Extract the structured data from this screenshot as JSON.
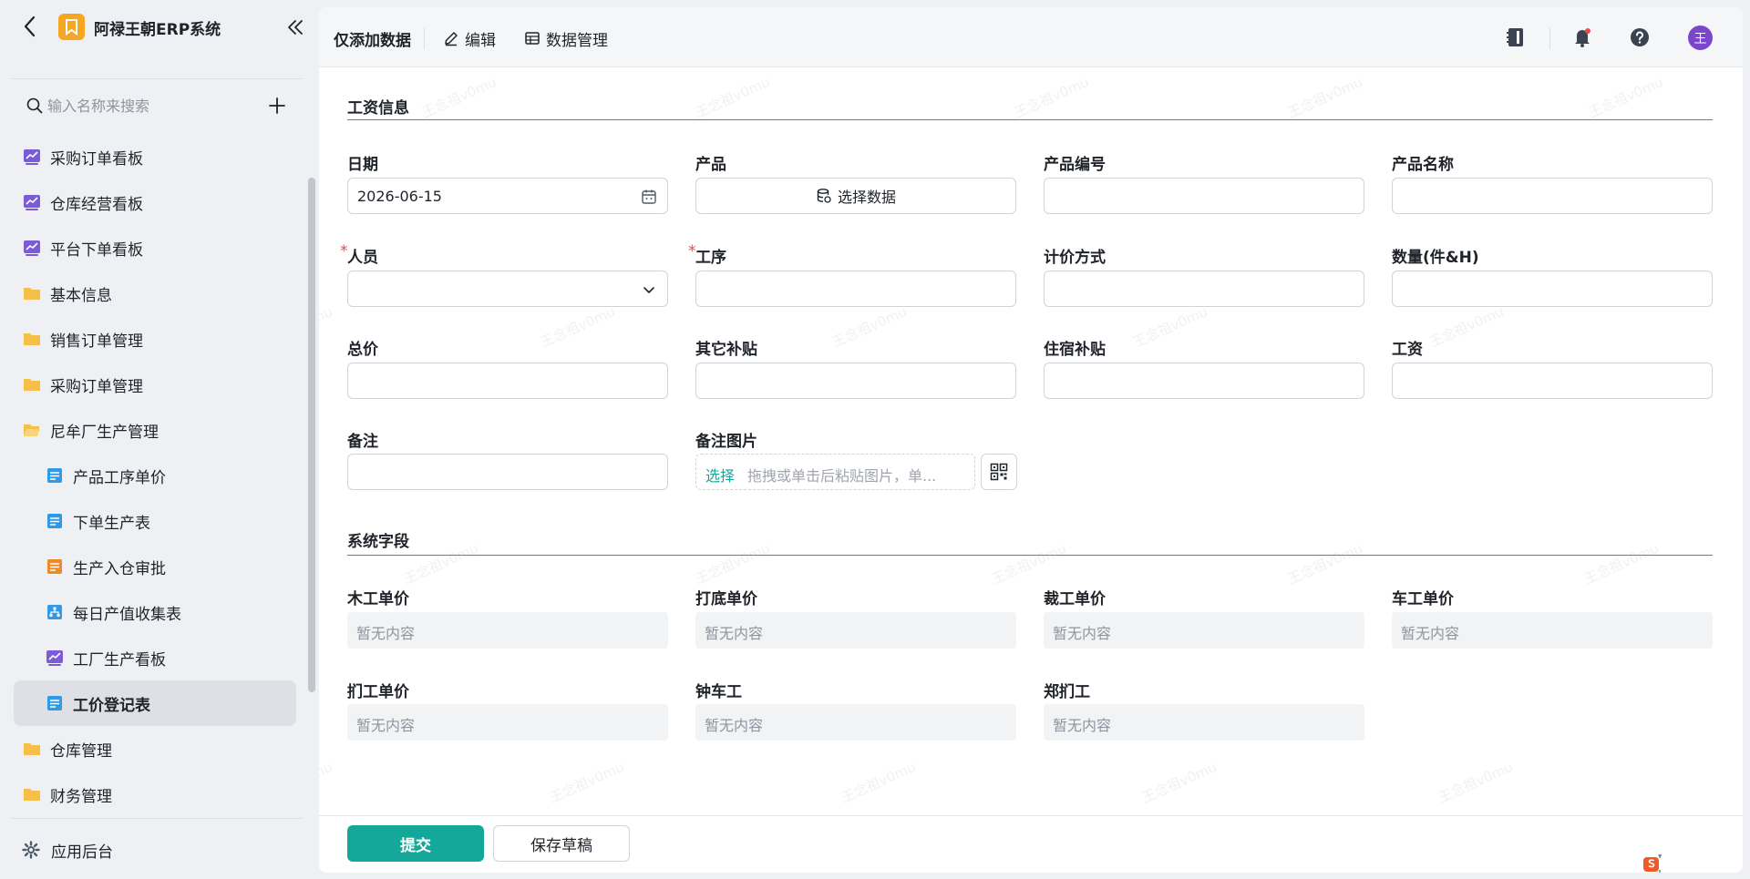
{
  "app": {
    "name": "阿禄王朝ERP系统"
  },
  "sidebar": {
    "search_placeholder": "输入名称来搜索",
    "items": [
      {
        "label": "采购订单看板",
        "icon": "dashboard-chart-icon"
      },
      {
        "label": "仓库经营看板",
        "icon": "dashboard-chart-icon"
      },
      {
        "label": "平台下单看板",
        "icon": "dashboard-chart-icon"
      },
      {
        "label": "基本信息",
        "icon": "folder-icon"
      },
      {
        "label": "销售订单管理",
        "icon": "folder-icon"
      },
      {
        "label": "采购订单管理",
        "icon": "folder-icon"
      },
      {
        "label": "尼牟厂生产管理",
        "icon": "folder-open-icon"
      },
      {
        "label": "产品工序单价",
        "icon": "form-icon"
      },
      {
        "label": "下单生产表",
        "icon": "form-icon"
      },
      {
        "label": "生产入仓审批",
        "icon": "approval-form-icon"
      },
      {
        "label": "每日产值收集表",
        "icon": "org-chart-icon"
      },
      {
        "label": "工厂生产看板",
        "icon": "dashboard-chart-icon"
      },
      {
        "label": "工价登记表",
        "icon": "form-icon",
        "active": true
      },
      {
        "label": "仓库管理",
        "icon": "folder-icon"
      },
      {
        "label": "财务管理",
        "icon": "folder-icon"
      }
    ],
    "footer_label": "应用后台"
  },
  "topbar": {
    "title": "仅添加数据",
    "tabs": [
      "编辑",
      "数据管理"
    ],
    "avatar_text": "王"
  },
  "form": {
    "section1_title": "工资信息",
    "labels": {
      "date": "日期",
      "product": "产品",
      "product_code": "产品编号",
      "product_name": "产品名称",
      "person": "人员",
      "process": "工序",
      "pricing": "计价方式",
      "quantity": "数量(件&H)",
      "total": "总价",
      "other_subsidy": "其它补贴",
      "housing_subsidy": "住宿补贴",
      "wage": "工资",
      "remark": "备注",
      "remark_image": "备注图片"
    },
    "values": {
      "date": "2026-06-15",
      "product_button": "选择数据"
    },
    "upload": {
      "pick": "选择",
      "hint": "拖拽或单击后粘贴图片，单..."
    },
    "section2_title": "系统字段",
    "system_fields": [
      {
        "label": "木工单价",
        "value": "暂无内容"
      },
      {
        "label": "打底单价",
        "value": "暂无内容"
      },
      {
        "label": "裁工单价",
        "value": "暂无内容"
      },
      {
        "label": "车工单价",
        "value": "暂无内容"
      },
      {
        "label": "扪工单价",
        "value": "暂无内容"
      },
      {
        "label": "钟车工",
        "value": "暂无内容"
      },
      {
        "label": "郑扪工",
        "value": "暂无内容"
      }
    ],
    "submit_label": "提交",
    "draft_label": "保存草稿"
  },
  "watermark": "王念祖v0mu",
  "colors": {
    "accent": "#14a89a",
    "avatar": "#7b46c9",
    "logo": "#f5a623",
    "required": "#e5484d"
  }
}
